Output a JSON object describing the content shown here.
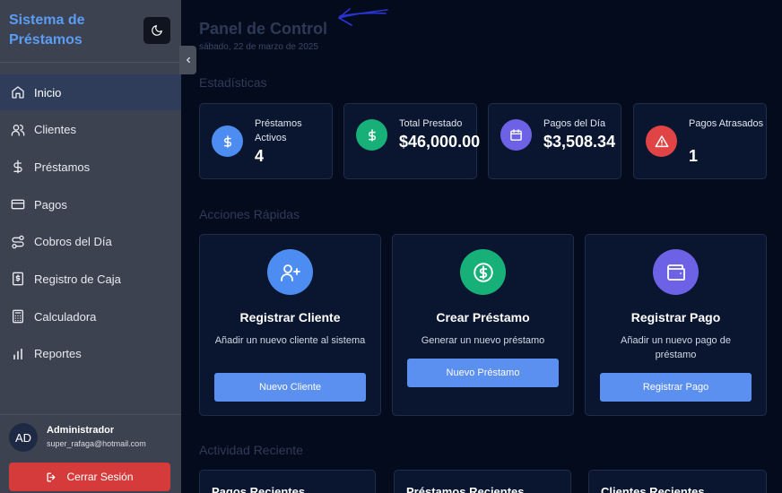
{
  "sidebar": {
    "brand": "Sistema de Préstamos",
    "items": [
      {
        "label": "Inicio",
        "icon": "home-icon"
      },
      {
        "label": "Clientes",
        "icon": "users-icon"
      },
      {
        "label": "Préstamos",
        "icon": "dollar-icon"
      },
      {
        "label": "Pagos",
        "icon": "card-icon"
      },
      {
        "label": "Cobros del Día",
        "icon": "route-icon"
      },
      {
        "label": "Registro de Caja",
        "icon": "cash-register-icon"
      },
      {
        "label": "Calculadora",
        "icon": "calculator-icon"
      },
      {
        "label": "Reportes",
        "icon": "chart-icon"
      }
    ],
    "active_index": 0
  },
  "user": {
    "initials": "AD",
    "name": "Administrador",
    "email": "super_rafaga@hotmail.com",
    "logout_label": "Cerrar Sesión"
  },
  "main": {
    "title": "Panel de Control",
    "date": "sábado, 22 de marzo de 2025",
    "stats_heading": "Estadísticas",
    "quick_heading": "Acciones Rápidas",
    "activity_heading": "Actividad Reciente"
  },
  "stats": [
    {
      "label": "Préstamos Activos",
      "value": "4",
      "icon": "dollar-icon",
      "color": "#4d8cf0"
    },
    {
      "label": "Total Prestado",
      "value": "$46,000.00",
      "icon": "dollar-icon",
      "color": "#16b078"
    },
    {
      "label": "Pagos del Día",
      "value": "$3,508.34",
      "icon": "calendar-icon",
      "color": "#6d62e6"
    },
    {
      "label": "Pagos Atrasados",
      "value": "1",
      "icon": "warning-icon",
      "color": "#e04444"
    }
  ],
  "actions": [
    {
      "title": "Registrar Cliente",
      "desc": "Añadir un nuevo cliente al sistema",
      "button": "Nuevo Cliente",
      "icon": "user-plus-icon",
      "color": "#4d8cf0"
    },
    {
      "title": "Crear Préstamo",
      "desc": "Generar un nuevo préstamo",
      "button": "Nuevo Préstamo",
      "icon": "dollar-circle-icon",
      "color": "#16b078"
    },
    {
      "title": "Registrar Pago",
      "desc": "Añadir un nuevo pago de préstamo",
      "button": "Registrar Pago",
      "icon": "wallet-icon",
      "color": "#6d62e6"
    }
  ],
  "recent": [
    {
      "title": "Pagos Recientes"
    },
    {
      "title": "Préstamos Recientes"
    },
    {
      "title": "Clientes Recientes"
    }
  ],
  "colors": {
    "accent": "#5b9cf5",
    "button": "#5b8ff0",
    "danger": "#d63b3b",
    "background": "#040b1d",
    "sidebar": "#3d4250"
  }
}
